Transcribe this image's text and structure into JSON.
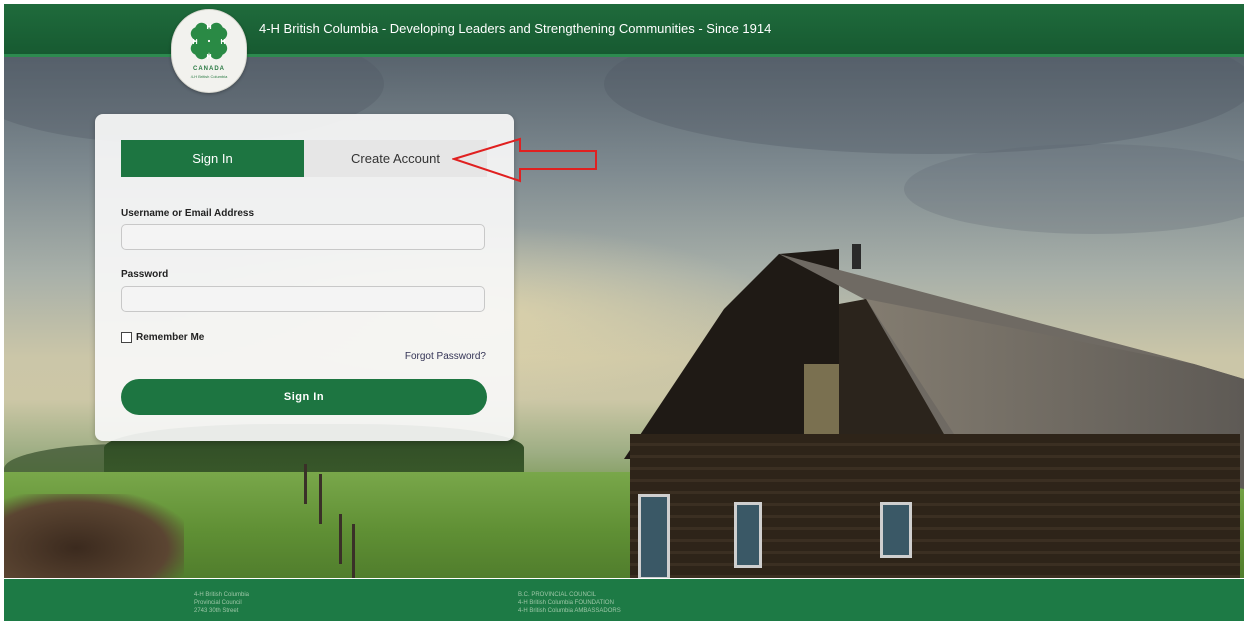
{
  "header": {
    "tagline": "4-H British Columbia - Developing Leaders and Strengthening Communities - Since 1914",
    "logo": {
      "icon": "4-h-clover-logo",
      "country": "CANADA",
      "region": "4-H British Columbia"
    }
  },
  "login": {
    "tabs": [
      {
        "label": "Sign In",
        "active": true
      },
      {
        "label": "Create Account",
        "active": false
      }
    ],
    "username_label": "Username or Email Address",
    "username_value": "",
    "password_label": "Password",
    "password_value": "",
    "remember_label": "Remember Me",
    "remember_checked": false,
    "forgot_label": "Forgot Password?",
    "submit_label": "Sign In"
  },
  "annotation": {
    "icon": "red-arrow-icon",
    "color": "#e02020"
  },
  "footer": {
    "col1": [
      "4-H British Columbia",
      "Provincial Council",
      "2743 30th Street"
    ],
    "col2": [
      "B.C. PROVINCIAL COUNCIL",
      "4-H British Columbia FOUNDATION",
      "4-H British Columbia AMBASSADORS"
    ]
  },
  "colors": {
    "brand_green": "#1d7541",
    "header_green": "#1f6b3c",
    "footer_green": "#1d7a45"
  }
}
